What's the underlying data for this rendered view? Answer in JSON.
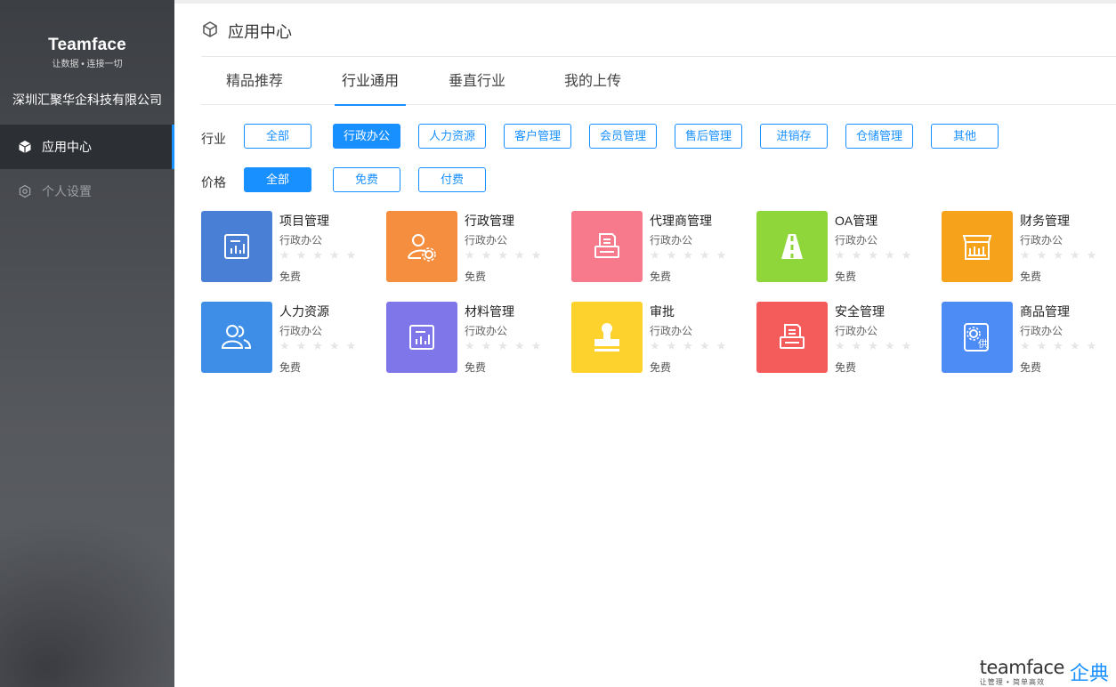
{
  "sidebar": {
    "logo_title": "Teamface",
    "logo_sub": "让数据 • 连接一切",
    "company": "深圳汇聚华企科技有限公司",
    "nav": [
      {
        "label": "应用中心",
        "icon": "cube-icon"
      },
      {
        "label": "个人设置",
        "icon": "gear-icon"
      }
    ]
  },
  "header": {
    "title": "应用中心",
    "icon": "cube-icon"
  },
  "tabs": [
    "精品推荐",
    "行业通用",
    "垂直行业",
    "我的上传"
  ],
  "active_tab": "行业通用",
  "filters": {
    "industry": {
      "label": "行业",
      "options": [
        "全部",
        "行政办公",
        "人力资源",
        "客户管理",
        "会员管理",
        "售后管理",
        "进销存",
        "仓储管理",
        "其他"
      ],
      "selected": "行政办公"
    },
    "price": {
      "label": "价格",
      "options": [
        "全部",
        "免费",
        "付费"
      ],
      "selected": "全部"
    }
  },
  "apps": [
    {
      "name": "项目管理",
      "category": "行政办公",
      "stars": "★★★★★",
      "price": "免费",
      "color": "#4a7fd6",
      "icon": "report-icon"
    },
    {
      "name": "行政管理",
      "category": "行政办公",
      "stars": "★★★★★",
      "price": "免费",
      "color": "#f58e3f",
      "icon": "user-gear-icon"
    },
    {
      "name": "代理商管理",
      "category": "行政办公",
      "stars": "★★★★★",
      "price": "免费",
      "color": "#f67a8c",
      "icon": "printer-icon"
    },
    {
      "name": "OA管理",
      "category": "行政办公",
      "stars": "★★★★★",
      "price": "免费",
      "color": "#8fd63b",
      "icon": "road-icon"
    },
    {
      "name": "财务管理",
      "category": "行政办公",
      "stars": "★★★★★",
      "price": "免费",
      "color": "#f7a21b",
      "icon": "shop-icon"
    },
    {
      "name": "人力资源",
      "category": "行政办公",
      "stars": "★★★★★",
      "price": "免费",
      "color": "#3e8ee8",
      "icon": "users-icon"
    },
    {
      "name": "材料管理",
      "category": "行政办公",
      "stars": "★★★★★",
      "price": "免费",
      "color": "#7f76ea",
      "icon": "report-icon"
    },
    {
      "name": "审批",
      "category": "行政办公",
      "stars": "★★★★★",
      "price": "免费",
      "color": "#fdd22c",
      "icon": "stamp-icon"
    },
    {
      "name": "安全管理",
      "category": "行政办公",
      "stars": "★★★★★",
      "price": "免费",
      "color": "#f45c5c",
      "icon": "printer-icon"
    },
    {
      "name": "商品管理",
      "category": "行政办公",
      "stars": "★★★★★",
      "price": "免费",
      "color": "#4d8cf5",
      "icon": "supply-icon"
    }
  ],
  "brand": {
    "en": "teamface",
    "sub": "让管理 • 简单高效",
    "cn": "企典"
  }
}
